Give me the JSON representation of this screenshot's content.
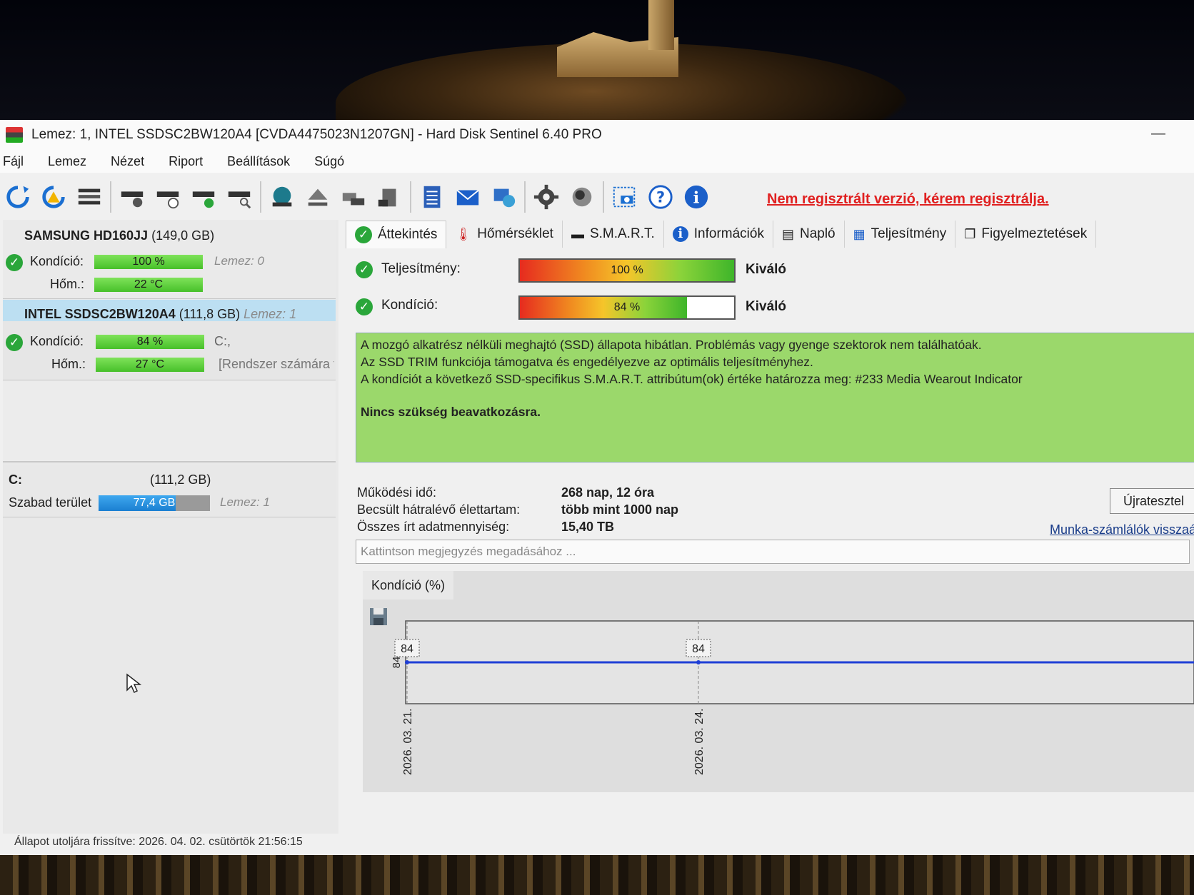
{
  "window": {
    "title": "Lemez: 1, INTEL SSDSC2BW120A4 [CVDA4475023N1207GN]  -  Hard Disk Sentinel 6.40 PRO",
    "minimize": "—"
  },
  "menu": [
    "Fájl",
    "Lemez",
    "Nézet",
    "Riport",
    "Beállítások",
    "Súgó"
  ],
  "register_link": "Nem regisztrált verzió, kérem regisztrálja.",
  "disks": [
    {
      "name": "SAMSUNG HD160JJ",
      "size": "(149,0 GB)",
      "condition_label": "Kondíció:",
      "condition_value": "100 %",
      "condition_pct": 100,
      "disk_ref": "Lemez: 0",
      "temp_label": "Hőm.:",
      "temp_value": "22 °C",
      "selected": false
    },
    {
      "name": "INTEL SSDSC2BW120A4",
      "size": "(111,8 GB)",
      "disk_ref": "Lemez: 1",
      "condition_label": "Kondíció:",
      "condition_value": "84 %",
      "condition_pct": 84,
      "partition_ref": "C:,",
      "temp_label": "Hőm.:",
      "temp_value": "27 °C",
      "system_note": "[Rendszer számára f",
      "selected": true
    }
  ],
  "volume": {
    "letter": "C:",
    "size": "(111,2 GB)",
    "free_label": "Szabad terület",
    "free_value": "77,4 GB",
    "free_fraction": 0.69,
    "disk_ref": "Lemez: 1"
  },
  "tabs": [
    "Áttekintés",
    "Hőmérséklet",
    "S.M.A.R.T.",
    "Információk",
    "Napló",
    "Teljesítmény",
    "Figyelmeztetések"
  ],
  "overview": {
    "performance_label": "Teljesítmény:",
    "performance_value": "100 %",
    "performance_pct": 100,
    "performance_rating": "Kiváló",
    "condition_label": "Kondíció:",
    "condition_value": "84 %",
    "condition_pct": 84,
    "condition_rating": "Kiváló",
    "status_lines": [
      "A mozgó alkatrész nélküli meghajtó (SSD) állapota hibátlan. Problémás vagy gyenge szektorok nem találhatóak.",
      "Az SSD TRIM funkciója támogatva és engedélyezve az optimális teljesítményhez.",
      "A kondíciót a következő SSD-specifikus S.M.A.R.T. attribútum(ok) értéke határozza meg:  #233 Media Wearout Indicator"
    ],
    "status_action": "Nincs szükség beavatkozásra.",
    "uptime_label": "Működési idő:",
    "uptime_value": "268 nap, 12 óra",
    "lifetime_label": "Becsült hátralévő élettartam:",
    "lifetime_value": "több mint 1000 nap",
    "written_label": "Összes írt adatmennyiség:",
    "written_value": "15,40 TB",
    "reset_button": "Újratesztel",
    "counters_link": "Munka-számlálók visszaá",
    "note_placeholder": "Kattintson megjegyzés megadásához ..."
  },
  "chart_data": {
    "type": "line",
    "title": "Kondíció  (%)",
    "x": [
      "2026. 03. 21.",
      "2026. 03. 24."
    ],
    "series": [
      {
        "values": [
          84,
          84
        ]
      }
    ],
    "ylabel_tick": "84",
    "ylim": [
      83,
      85
    ],
    "color": "#1f3fd6"
  },
  "statusbar": "Állapot utoljára frissítve: 2026. 04. 02. csütörtök 21:56:15"
}
